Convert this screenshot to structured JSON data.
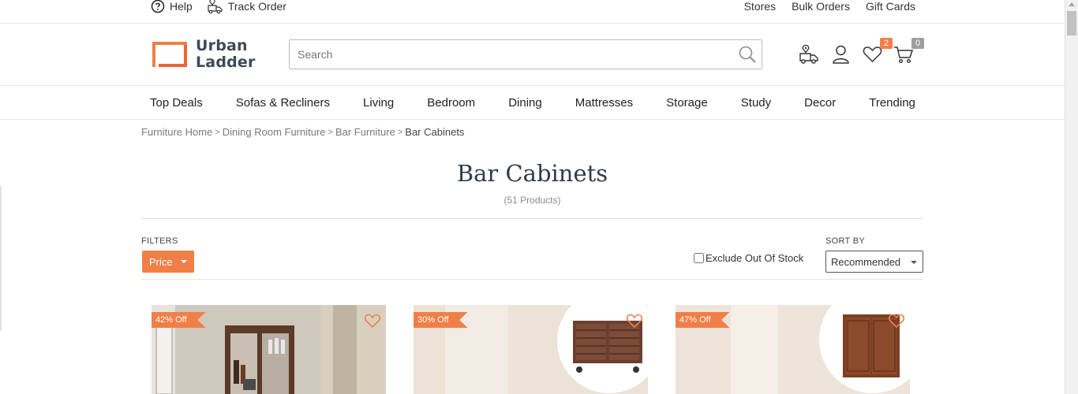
{
  "topbar": {
    "help": "Help",
    "track_order": "Track Order",
    "stores": "Stores",
    "bulk_orders": "Bulk Orders",
    "gift_cards": "Gift Cards"
  },
  "logo": {
    "line1": "Urban",
    "line2": "Ladder"
  },
  "search": {
    "placeholder": "Search"
  },
  "header_icons": {
    "wishlist_count": "2",
    "cart_count": "0"
  },
  "nav": [
    "Top Deals",
    "Sofas & Recliners",
    "Living",
    "Bedroom",
    "Dining",
    "Mattresses",
    "Storage",
    "Study",
    "Decor",
    "Trending"
  ],
  "breadcrumb": [
    "Furniture Home",
    "Dining Room Furniture",
    "Bar Furniture",
    "Bar Cabinets"
  ],
  "page": {
    "title": "Bar Cabinets",
    "count": "(51 Products)"
  },
  "filters": {
    "label": "FILTERS",
    "price": "Price"
  },
  "exclude_label": "Exclude Out Of Stock",
  "sort": {
    "label": "SORT BY",
    "value": "Recommended"
  },
  "products": [
    {
      "discount": "42% Off"
    },
    {
      "discount": "30% Off"
    },
    {
      "discount": "47% Off"
    }
  ],
  "colors": {
    "accent": "#f07f47",
    "badge_wishlist": "#f07f47",
    "badge_cart": "#9e9e9e",
    "text_dark": "#2f3b48"
  }
}
